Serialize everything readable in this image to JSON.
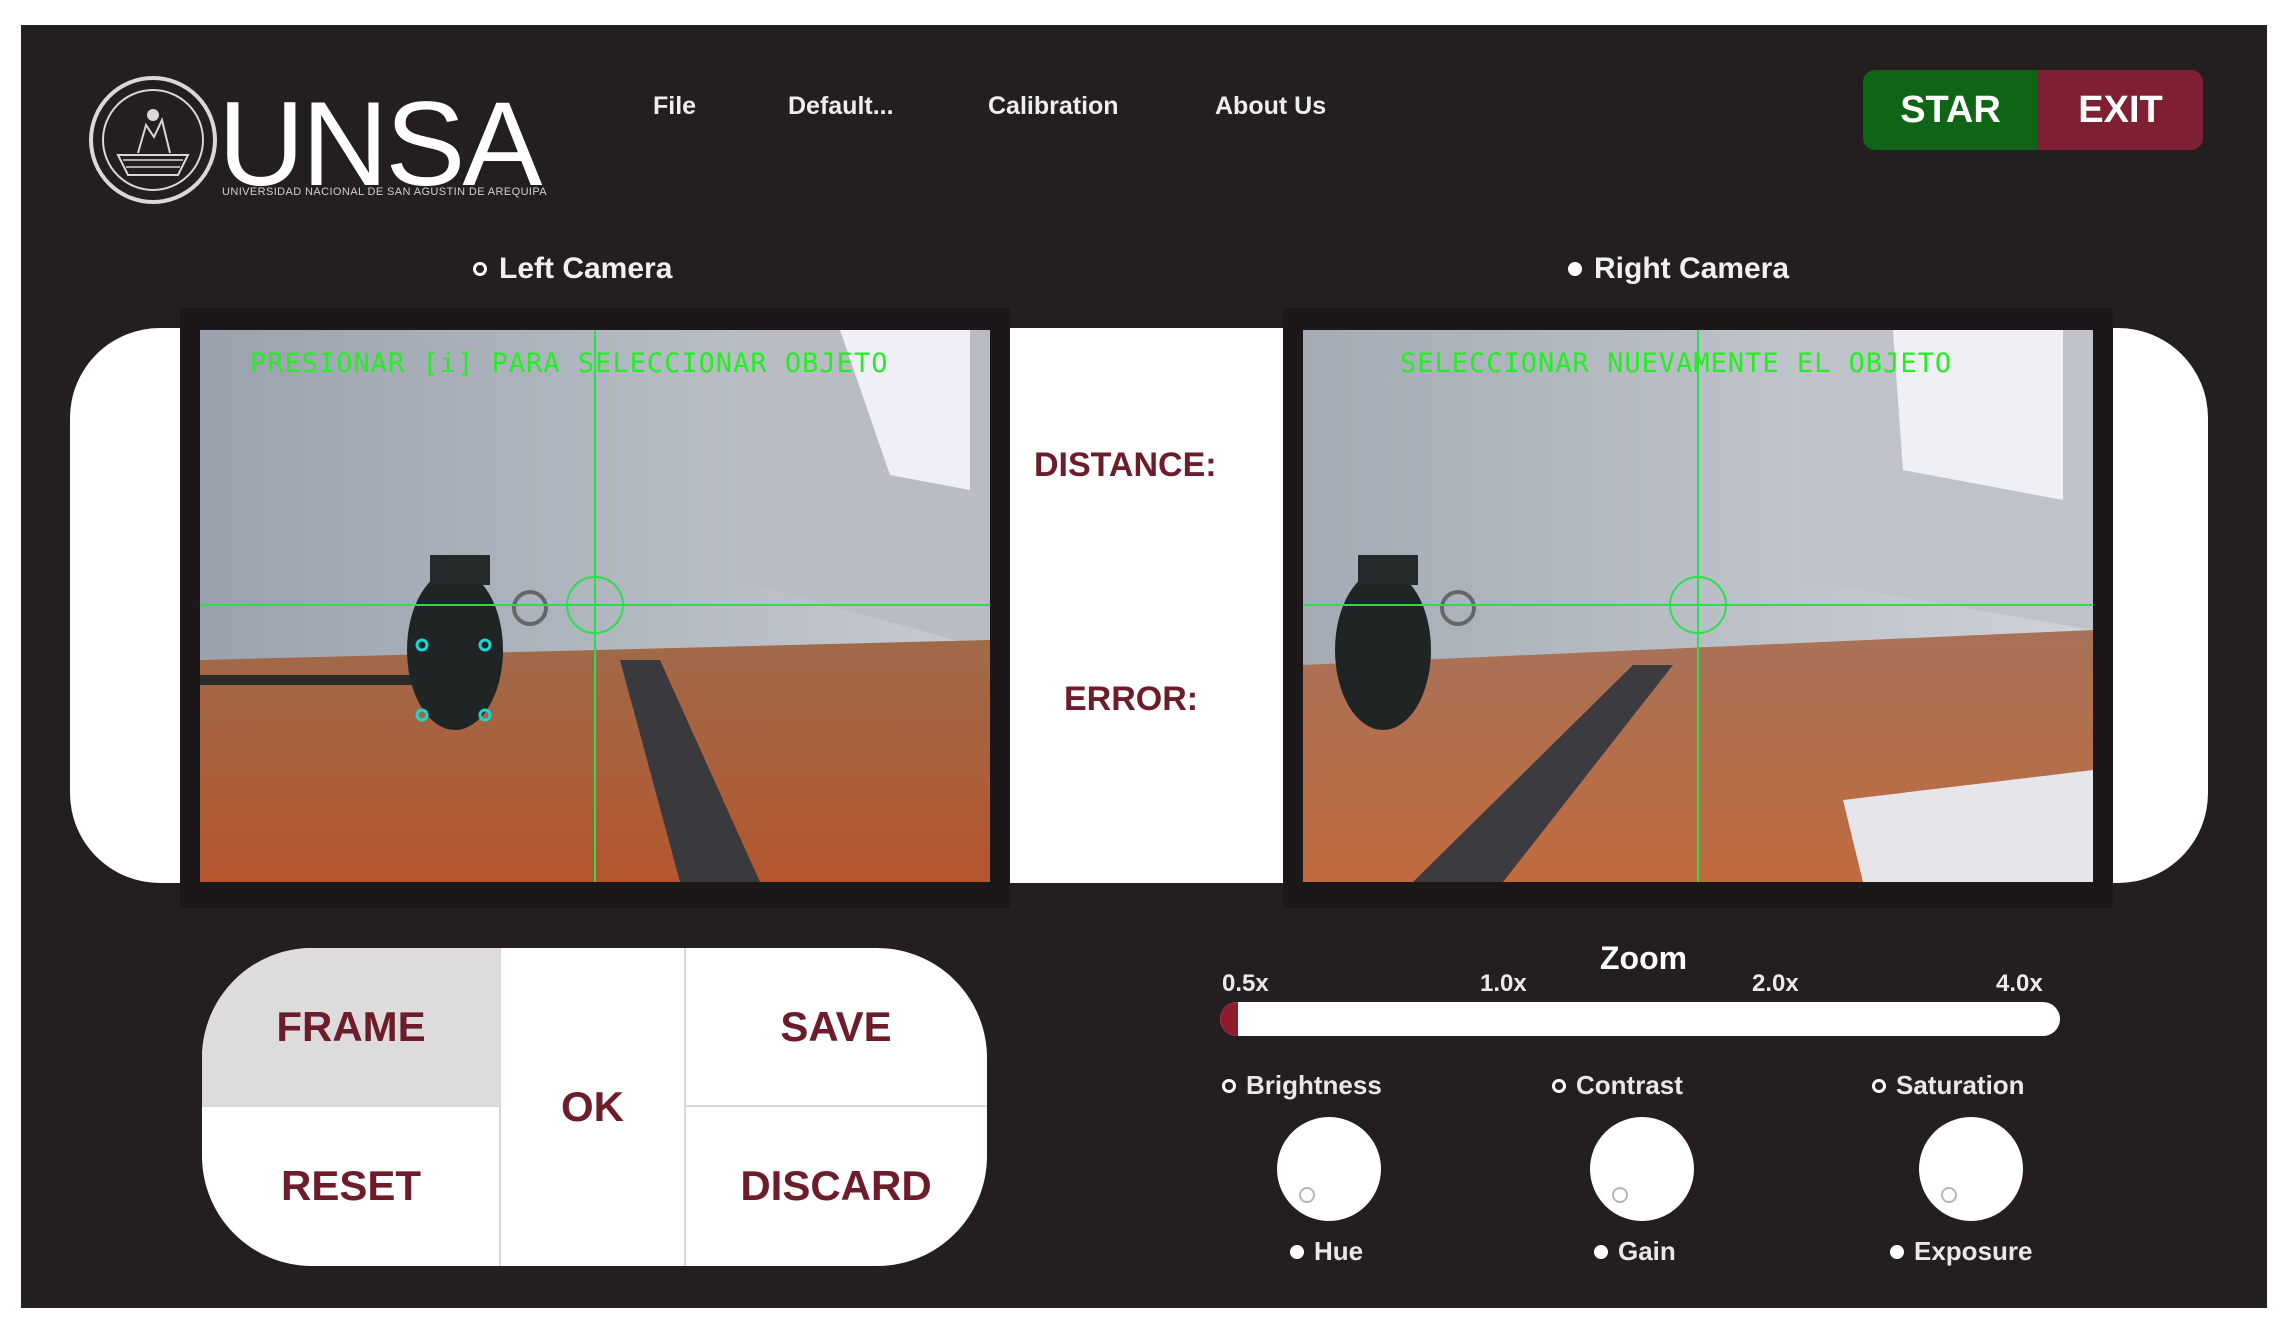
{
  "header": {
    "logo_text": "UNSA",
    "logo_subtitle": "UNIVERSIDAD NACIONAL DE SAN AGUSTIN DE AREQUIPA",
    "menu": [
      {
        "label": "File"
      },
      {
        "label": "Default..."
      },
      {
        "label": "Calibration"
      },
      {
        "label": "About Us"
      }
    ],
    "star_label": "STAR",
    "exit_label": "EXIT",
    "colors": {
      "star": "#0f6415",
      "exit": "#7e2031",
      "background": "#231e20"
    }
  },
  "cameras": {
    "left": {
      "label": "Left Camera",
      "selected": false,
      "overlay": "PRESIONAR [i] PARA SELECCIONAR OBJETO"
    },
    "right": {
      "label": "Right Camera",
      "selected": true,
      "overlay": "SELECCIONAR NUEVAMENTE EL OBJETO"
    },
    "overlay_color": "#22ee22"
  },
  "measurements": {
    "distance_label": "DISTANCE:",
    "error_label": "ERROR:"
  },
  "controls": {
    "frame": "FRAME",
    "reset": "RESET",
    "ok": "OK",
    "save": "SAVE",
    "discard": "DISCARD",
    "text_color": "#6d1c29"
  },
  "zoom": {
    "title": "Zoom",
    "ticks": [
      "0.5x",
      "1.0x",
      "2.0x",
      "4.0x"
    ],
    "value": "0.5x",
    "fill_fraction": 0.02
  },
  "adjustments": {
    "top": [
      {
        "label": "Brightness",
        "selected": false
      },
      {
        "label": "Contrast",
        "selected": false
      },
      {
        "label": "Saturation",
        "selected": false
      }
    ],
    "bottom": [
      {
        "label": "Hue",
        "selected": true
      },
      {
        "label": "Gain",
        "selected": true
      },
      {
        "label": "Exposure",
        "selected": true
      }
    ]
  }
}
